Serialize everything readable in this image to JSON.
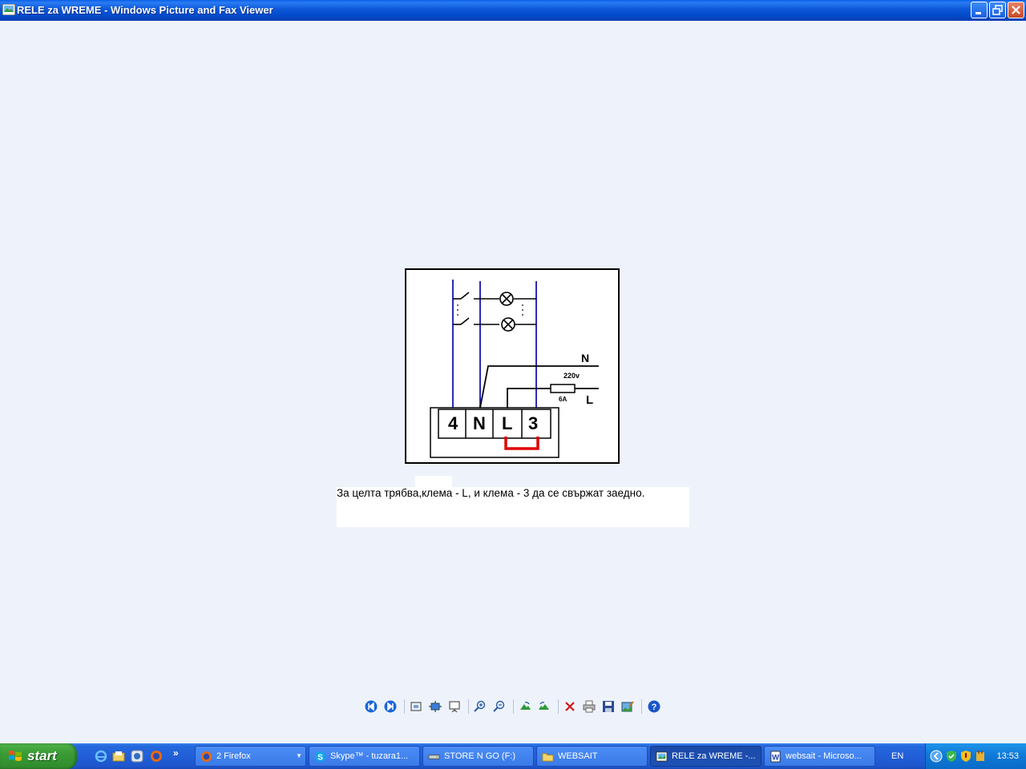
{
  "window": {
    "title": "RELE za WREME - Windows Picture and Fax Viewer",
    "minimize_icon": "minimize-icon",
    "restore_icon": "restore-icon",
    "close_icon": "close-icon"
  },
  "picture": {
    "terminals": [
      "4",
      "N",
      "L",
      "3"
    ],
    "label_n": "N",
    "label_l": "L",
    "label_voltage": "220v",
    "label_fuse": "6A",
    "jumper_color": "#e00000",
    "wire_color": "#2b2bb8"
  },
  "caption": "За целта трябва,клема - L, и клема - 3 да се свържат заедно.",
  "toolbar": {
    "buttons": [
      "previous-image-icon",
      "next-image-icon",
      "best-fit-icon",
      "actual-size-icon",
      "slideshow-icon",
      "zoom-in-icon",
      "zoom-out-icon",
      "rotate-clockwise-icon",
      "rotate-counterclockwise-icon",
      "delete-icon",
      "print-icon",
      "save-icon",
      "edit-icon",
      "help-icon"
    ]
  },
  "taskbar": {
    "start_label": "start",
    "tasks": [
      {
        "label": "2 Firefox",
        "icon": "firefox-icon",
        "has_arrow": true
      },
      {
        "label": "Skype™ - tuzara1...",
        "icon": "skype-icon"
      },
      {
        "label": "STORE N GO (F:)",
        "icon": "drive-icon"
      },
      {
        "label": "WEBSAIT",
        "icon": "folder-icon"
      },
      {
        "label": "RELE za WREME -...",
        "icon": "picture-viewer-icon",
        "active": true
      },
      {
        "label": "websait - Microso...",
        "icon": "word-icon"
      }
    ],
    "language": "EN",
    "clock": "13:53",
    "quicklaunch_chevron": "»"
  }
}
